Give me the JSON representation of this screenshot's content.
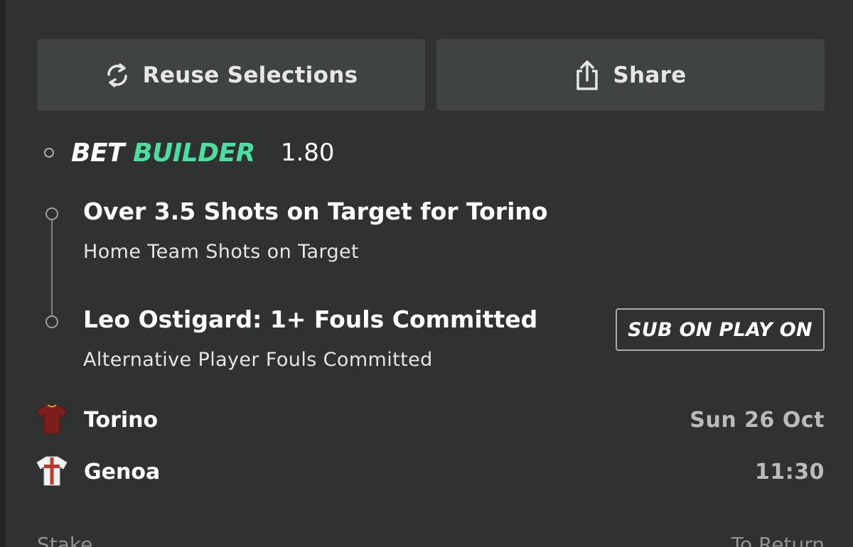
{
  "actions": {
    "reuse_label": "Reuse Selections",
    "share_label": "Share"
  },
  "bet_builder": {
    "word_bet": "BET",
    "word_builder": "BUILDER",
    "odds": "1.80"
  },
  "legs": [
    {
      "title": "Over 3.5 Shots on Target for Torino",
      "market": "Home Team Shots on Target"
    },
    {
      "title": "Leo Ostigard: 1+ Fouls Committed",
      "market": "Alternative Player Fouls Committed",
      "action_label": "SUB ON PLAY ON"
    }
  ],
  "match": {
    "home": "Torino",
    "away": "Genoa",
    "date": "Sun 26 Oct",
    "time": "11:30"
  },
  "footer": {
    "stake_label": "Stake",
    "return_label": "To Return"
  },
  "colors": {
    "accent": "#4cdda0",
    "background": "#2f3231",
    "button": "#3f4341",
    "torino_kit": "#7a1f1c",
    "genoa_kit_cross": "#c0392b"
  }
}
